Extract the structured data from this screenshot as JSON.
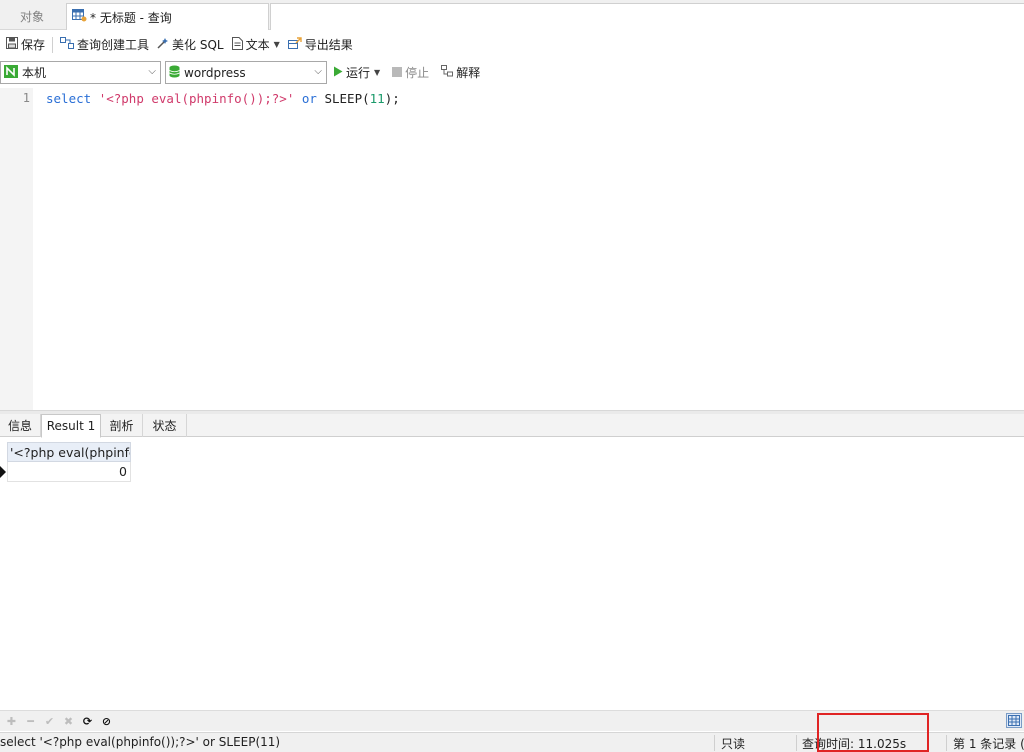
{
  "tabs": {
    "objects": "对象",
    "query_title": "* 无标题 - 查询"
  },
  "toolbar": {
    "save": "保存",
    "query_builder": "查询创建工具",
    "beautify_sql": "美化 SQL",
    "text": "文本",
    "export": "导出结果"
  },
  "connection": {
    "server": "本机",
    "database": "wordpress",
    "run": "运行",
    "stop": "停止",
    "explain": "解释"
  },
  "editor": {
    "line_number": "1",
    "tokens": {
      "kw_select": "select",
      "str": "'<?php eval(phpinfo());?>'",
      "kw_or": "or",
      "func": "SLEEP(",
      "num": "11",
      "end": ");"
    }
  },
  "result_tabs": [
    "信息",
    "Result 1",
    "剖析",
    "状态"
  ],
  "grid": {
    "columns": [
      "'<?php eval(phpinfo"
    ],
    "rows": [
      [
        "0"
      ]
    ]
  },
  "status": {
    "sql": "select '<?php eval(phpinfo());?>' or SLEEP(11)",
    "readonly": "只读",
    "query_time": "查询时间: 11.025s",
    "record": "第 1 条记录 ("
  },
  "colors": {
    "accent_green": "#3aaa35",
    "highlight_red": "#e02424",
    "keyword_blue": "#2a6fd6",
    "string_red": "#d03a6b"
  }
}
